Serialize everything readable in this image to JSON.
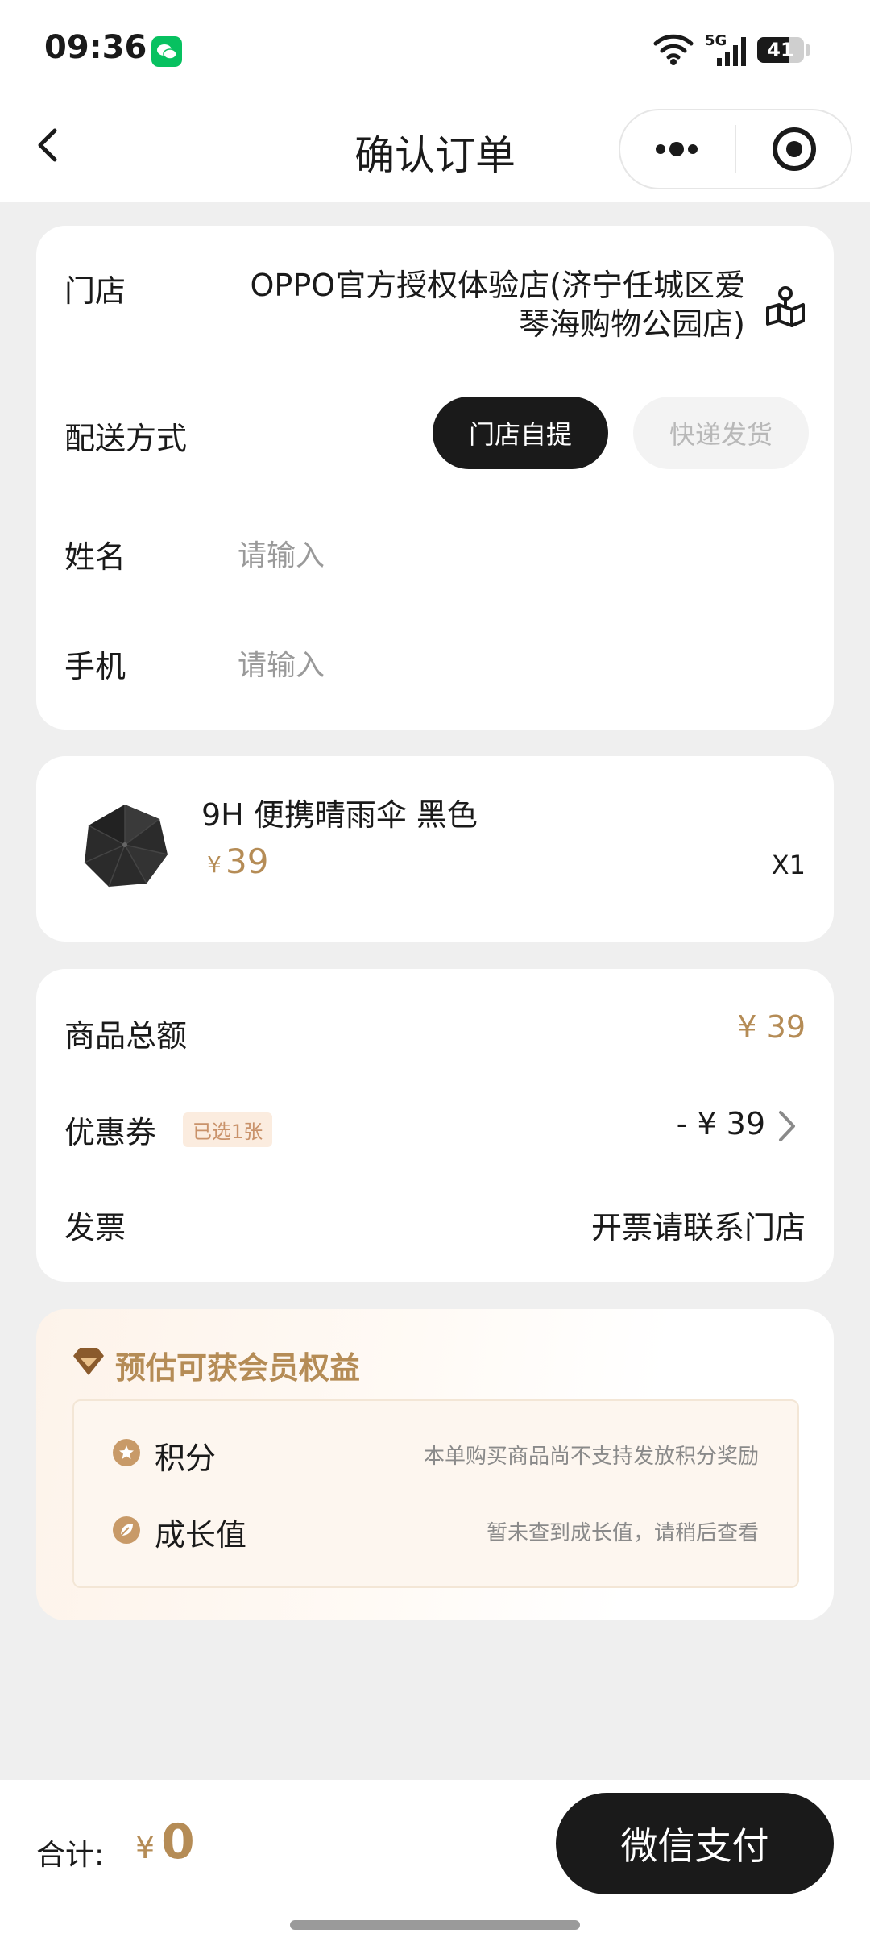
{
  "status": {
    "time": "09:36",
    "network": "5G",
    "battery": "41"
  },
  "nav": {
    "title": "确认订单"
  },
  "store": {
    "label": "门店",
    "name": "OPPO官方授权体验店(济宁任城区爱琴海购物公园店)"
  },
  "delivery": {
    "label": "配送方式",
    "option_pickup": "门店自提",
    "option_express": "快递发货"
  },
  "name_field": {
    "label": "姓名",
    "placeholder": "请输入"
  },
  "phone_field": {
    "label": "手机",
    "placeholder": "请输入"
  },
  "product": {
    "title": "9H 便携晴雨伞 黑色",
    "currency": "¥",
    "price": "39",
    "quantity": "X1"
  },
  "summary": {
    "total_label": "商品总额",
    "total_value": "¥ 39",
    "coupon_label": "优惠券",
    "coupon_badge": "已选1张",
    "coupon_value": "- ¥ 39",
    "invoice_label": "发票",
    "invoice_value": "开票请联系门店"
  },
  "member": {
    "title": "预估可获会员权益",
    "points_label": "积分",
    "points_desc": "本单购买商品尚不支持发放积分奖励",
    "growth_label": "成长值",
    "growth_desc": "暂未查到成长值，请稍后查看"
  },
  "footer": {
    "total_label": "合计:",
    "currency": "¥",
    "total_value": "0",
    "pay_button": "微信支付"
  },
  "colors": {
    "accent_gold": "#b58c56",
    "dark": "#1a1a1a",
    "wechat_green": "#07c160"
  }
}
